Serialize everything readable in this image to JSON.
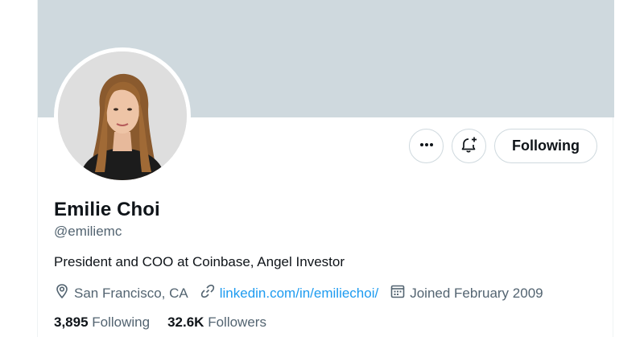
{
  "profile": {
    "name": "Emilie Choi",
    "handle": "@emiliemc",
    "bio": "President and COO at Coinbase, Angel Investor",
    "location": "San Francisco, CA",
    "website": "linkedin.com/in/emiliechoi/",
    "joined": "Joined February 2009"
  },
  "actions": {
    "more_icon": "more-icon",
    "notify_icon": "bell-plus-icon",
    "follow_label": "Following"
  },
  "stats": {
    "following_count": "3,895",
    "following_label": "Following",
    "followers_count": "32.6K",
    "followers_label": "Followers"
  },
  "colors": {
    "banner": "#cfd9de",
    "link": "#1d9bf0",
    "secondary_text": "#536471"
  }
}
